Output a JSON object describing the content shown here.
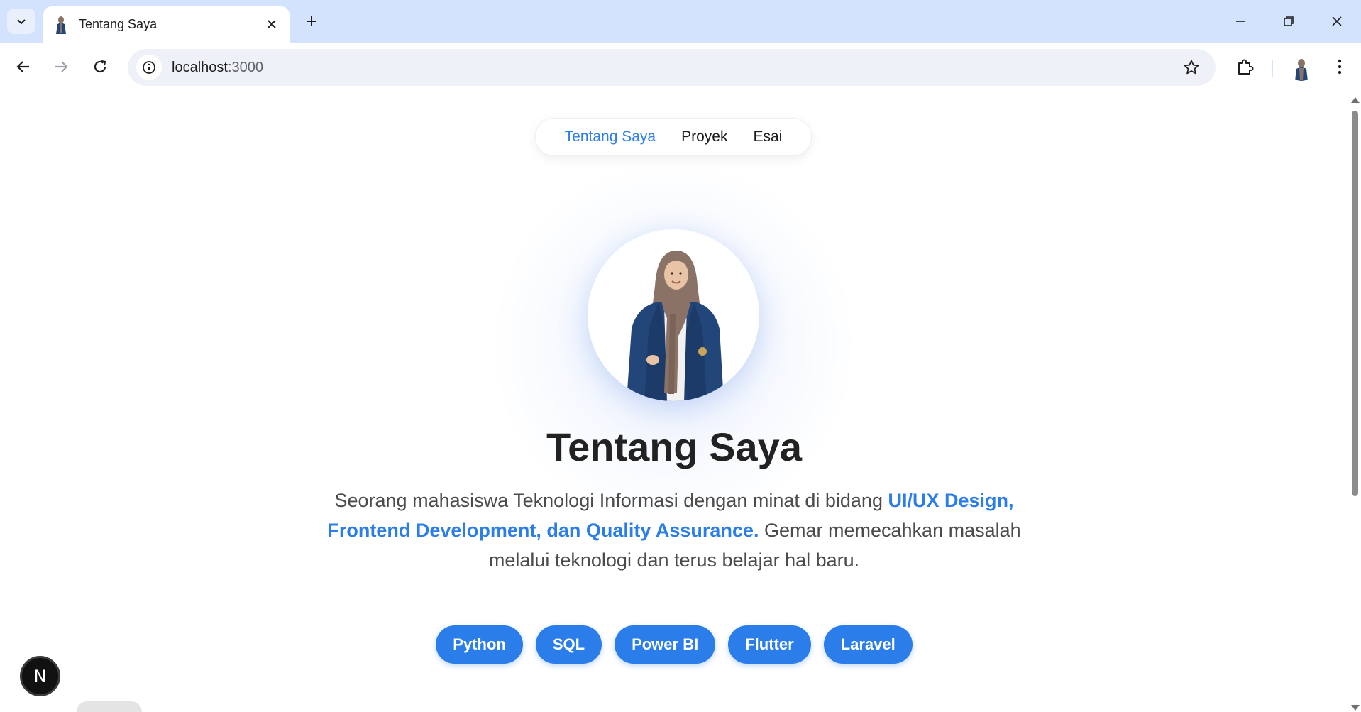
{
  "browser": {
    "tab_title": "Tentang Saya",
    "url_host": "localhost",
    "url_port": ":3000"
  },
  "nav": {
    "items": [
      {
        "label": "Tentang Saya",
        "active": true
      },
      {
        "label": "Proyek",
        "active": false
      },
      {
        "label": "Esai",
        "active": false
      }
    ]
  },
  "hero": {
    "title": "Tentang Saya",
    "desc_part1": "Seorang mahasiswa Teknologi Informasi dengan minat di bidang ",
    "desc_highlight": "UI/UX Design, Frontend Development, dan Quality Assurance.",
    "desc_part2": " Gemar memecahkan masalah melalui teknologi dan terus belajar hal baru."
  },
  "skills": [
    "Python",
    "SQL",
    "Power BI",
    "Flutter",
    "Laravel"
  ],
  "dev_badge": "N",
  "colors": {
    "accent": "#2b7de9",
    "chrome_tabbar": "#d3e3fd",
    "blazer": "#23467a",
    "hijab": "#8a7366"
  },
  "icons": {
    "tab_search": "chevron-down-icon",
    "tab_close": "close-icon",
    "new_tab": "plus-icon",
    "back": "arrow-left-icon",
    "forward": "arrow-right-icon",
    "reload": "reload-icon",
    "site_info": "info-icon",
    "bookmark": "star-icon",
    "extensions": "puzzle-icon",
    "menu": "kebab-menu-icon"
  }
}
